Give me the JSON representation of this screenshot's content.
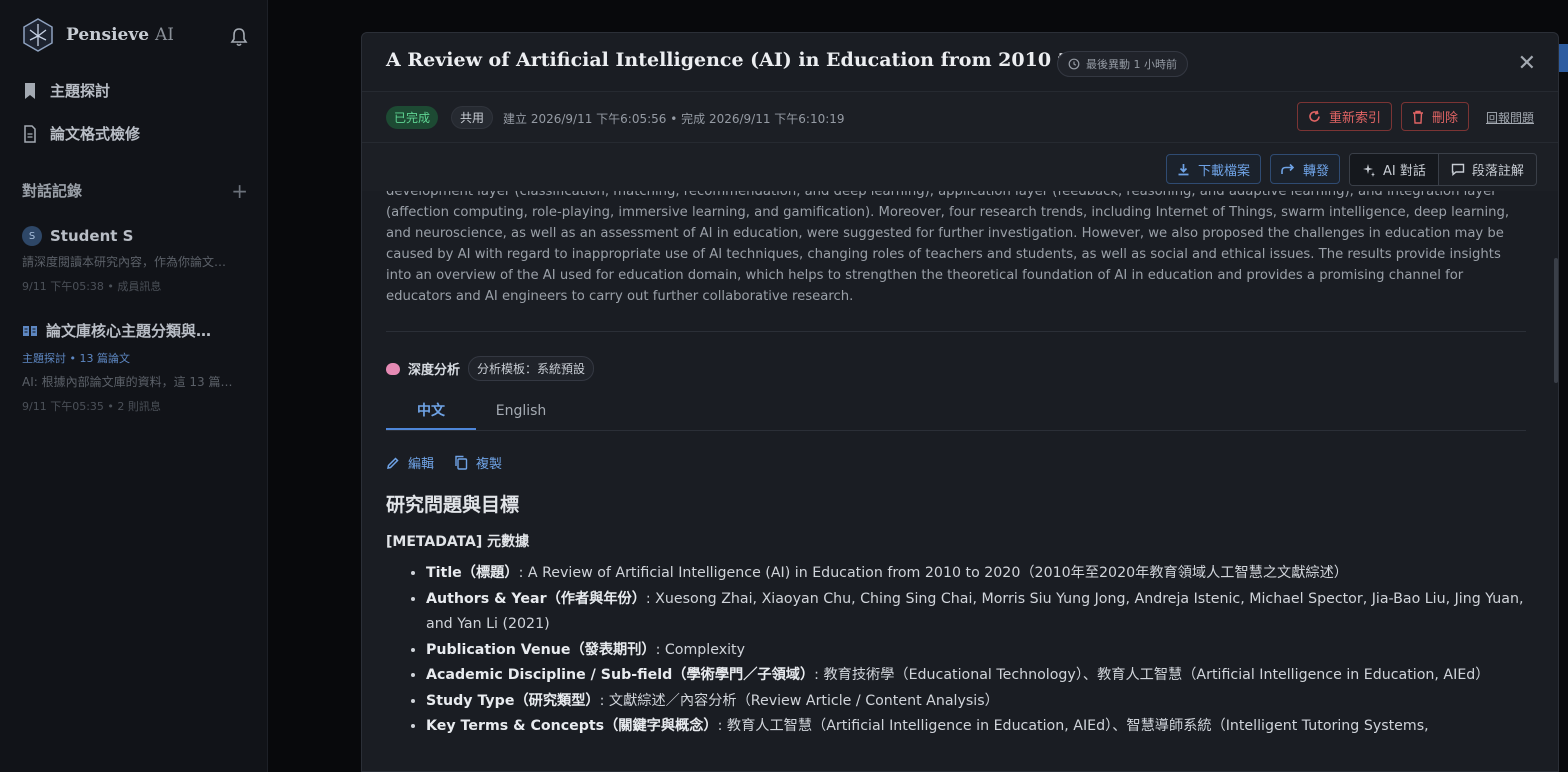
{
  "sidebar": {
    "brand": {
      "name": "Pensieve",
      "suffix": "AI"
    },
    "nav": [
      {
        "label": "主題探討",
        "icon": "bookmark-icon"
      },
      {
        "label": "論文格式檢修",
        "icon": "document-icon"
      }
    ],
    "history_title": "對話記錄",
    "conversations": [
      {
        "avatar": "S",
        "title": "Student S",
        "snippet": "請深度閱讀本研究內容，作為你論文…",
        "meta": "9/11 下午05:38 • 成員訊息"
      },
      {
        "title": "論文庫核心主題分類與…",
        "tag": "主題探討 • 13 篇論文",
        "snippet": "AI: 根據內部論文庫的資料，這 13 篇…",
        "meta": "9/11 下午05:35 • 2 則訊息"
      }
    ]
  },
  "modal": {
    "title": "A Review of Artificial Intelligence (AI) in Education from 2010 to 2020",
    "updated": "最後異動 1 小時前",
    "status": "已完成",
    "share": "共用",
    "timestamps": "建立 2026/9/11 下午6:05:56 • 完成 2026/9/11 下午6:10:19",
    "reindex": "重新索引",
    "delete": "刪除",
    "report": "回報問題",
    "download": "下載檔案",
    "forward": "轉發",
    "ai_chat": "AI 對話",
    "annotate": "段落註解",
    "abstract": "development layer (classification, matching, recommendation, and deep learning), application layer (feedback, reasoning, and adaptive learning), and integration layer (affection computing, role-playing, immersive learning, and gamification). Moreover, four research trends, including Internet of Things, swarm intelligence, deep learning, and neuroscience, as well as an assessment of AI in education, were suggested for further investigation. However, we also proposed the challenges in education may be caused by AI with regard to inappropriate use of AI techniques, changing roles of teachers and students, as well as social and ethical issues. The results provide insights into an overview of the AI used for education domain, which helps to strengthen the theoretical foundation of AI in education and provides a promising channel for educators and AI engineers to carry out further collaborative research.",
    "analysis_label": "深度分析",
    "template": "分析模板：系統預設",
    "tabs": [
      "中文",
      "English"
    ],
    "edit": "編輯",
    "copy": "複製",
    "h1": "研究問題與目標",
    "h2": "[METADATA] 元數據",
    "items": [
      {
        "k": "Title（標題）",
        "v": ": A Review of Artificial Intelligence (AI) in Education from 2010 to 2020（2010年至2020年教育領域人工智慧之文獻綜述）"
      },
      {
        "k": "Authors & Year（作者與年份）",
        "v": ": Xuesong Zhai, Xiaoyan Chu, Ching Sing Chai, Morris Siu Yung Jong, Andreja Istenic, Michael Spector, Jia-Bao Liu, Jing Yuan, and Yan Li (2021)"
      },
      {
        "k": "Publication Venue（發表期刊）",
        "v": ": Complexity"
      },
      {
        "k": "Academic Discipline / Sub-field（學術學門／子領域）",
        "v": ": 教育技術學（Educational Technology）、教育人工智慧（Artificial Intelligence in Education, AIEd）"
      },
      {
        "k": "Study Type（研究類型）",
        "v": ": 文獻綜述／內容分析（Review Article / Content Analysis）"
      },
      {
        "k": "Key Terms & Concepts（關鍵字與概念）",
        "v": ": 教育人工智慧（Artificial Intelligence in Education, AIEd）、智慧導師系統（Intelligent Tutoring Systems,"
      }
    ]
  }
}
